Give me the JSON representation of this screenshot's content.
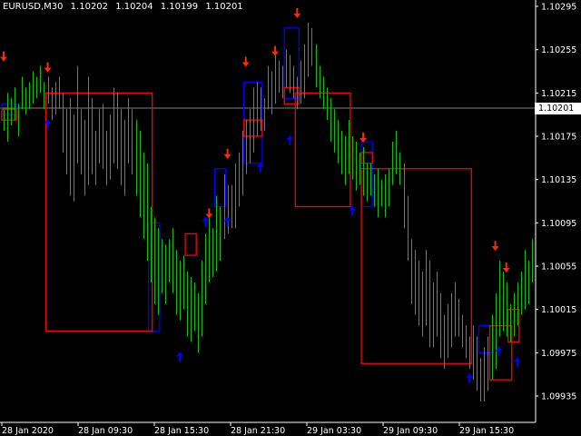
{
  "header": {
    "symbol_timeframe": "EURUSD,M30",
    "open": "1.10202",
    "high": "1.10204",
    "low": "1.10199",
    "close": "1.10201"
  },
  "current_price_label": "1.10201",
  "colors": {
    "background": "#000000",
    "bars": "#00c800",
    "up_box": "#0000ff",
    "down_box": "#ff0000",
    "up_arrow": "#0000ff",
    "down_arrow": "#ff2a00",
    "axis_text": "#ffffff",
    "price_line": "#808080"
  },
  "chart_data": {
    "type": "bar",
    "instrument": "EURUSD",
    "timeframe": "M30",
    "y_axis_ticks": [
      "1.10295",
      "1.10255",
      "1.10215",
      "1.10175",
      "1.10135",
      "1.10095",
      "1.10055",
      "1.10015",
      "1.09975",
      "1.09935"
    ],
    "x_axis_ticks": [
      "28 Jan 2020",
      "28 Jan 09:30",
      "28 Jan 15:30",
      "28 Jan 21:30",
      "29 Jan 03:30",
      "29 Jan 09:30",
      "29 Jan 15:30"
    ],
    "ylim": [
      1.09915,
      1.103
    ],
    "current_price": 1.10201,
    "bars": [
      [
        1.102,
        1.1018
      ],
      [
        1.10215,
        1.1017
      ],
      [
        1.1021,
        1.10185
      ],
      [
        1.1022,
        1.1019
      ],
      [
        1.10205,
        1.10175
      ],
      [
        1.1023,
        1.102
      ],
      [
        1.1022,
        1.10195
      ],
      [
        1.10225,
        1.102
      ],
      [
        1.10235,
        1.10205
      ],
      [
        1.1023,
        1.1021
      ],
      [
        1.1024,
        1.10215
      ],
      [
        1.10225,
        1.102
      ],
      [
        1.1023,
        1.10205
      ],
      [
        1.1022,
        1.1019
      ],
      [
        1.10225,
        1.10195
      ],
      [
        1.1023,
        1.102
      ],
      [
        1.10215,
        1.1016
      ],
      [
        1.102,
        1.1014
      ],
      [
        1.1021,
        1.1012
      ],
      [
        1.10195,
        1.10115
      ],
      [
        1.1024,
        1.1015
      ],
      [
        1.102,
        1.1014
      ],
      [
        1.1019,
        1.1012
      ],
      [
        1.1023,
        1.1013
      ],
      [
        1.1021,
        1.1014
      ],
      [
        1.1018,
        1.1013
      ],
      [
        1.102,
        1.1015
      ],
      [
        1.10205,
        1.10145
      ],
      [
        1.1018,
        1.1013
      ],
      [
        1.10195,
        1.10135
      ],
      [
        1.1022,
        1.1015
      ],
      [
        1.10215,
        1.10145
      ],
      [
        1.102,
        1.1013
      ],
      [
        1.1019,
        1.1012
      ],
      [
        1.1021,
        1.1015
      ],
      [
        1.102,
        1.1014
      ],
      [
        1.1019,
        1.1012
      ],
      [
        1.1018,
        1.101
      ],
      [
        1.1016,
        1.1008
      ],
      [
        1.1015,
        1.1006
      ],
      [
        1.1011,
        1.1004
      ],
      [
        1.101,
        1.1002
      ],
      [
        1.1009,
        1.1001
      ],
      [
        1.1008,
        1.1003
      ],
      [
        1.10075,
        1.1002
      ],
      [
        1.1008,
        1.1004
      ],
      [
        1.1009,
        1.1003
      ],
      [
        1.1007,
        1.1001
      ],
      [
        1.1006,
        1.10005
      ],
      [
        1.10065,
        1.10015
      ],
      [
        1.1005,
        1.0999
      ],
      [
        1.10045,
        1.09985
      ],
      [
        1.1004,
        1.09995
      ],
      [
        1.1003,
        1.09975
      ],
      [
        1.1006,
        1.0999
      ],
      [
        1.10085,
        1.1002
      ],
      [
        1.101,
        1.1004
      ],
      [
        1.1009,
        1.10045
      ],
      [
        1.1012,
        1.1005
      ],
      [
        1.1011,
        1.1006
      ],
      [
        1.1014,
        1.1008
      ],
      [
        1.1013,
        1.10085
      ],
      [
        1.1013,
        1.1009
      ],
      [
        1.1015,
        1.1009
      ],
      [
        1.1016,
        1.1011
      ],
      [
        1.1018,
        1.1012
      ],
      [
        1.1019,
        1.1014
      ],
      [
        1.102,
        1.1015
      ],
      [
        1.1022,
        1.1016
      ],
      [
        1.10225,
        1.10175
      ],
      [
        1.1022,
        1.1018
      ],
      [
        1.1021,
        1.1018
      ],
      [
        1.1024,
        1.102
      ],
      [
        1.10235,
        1.10195
      ],
      [
        1.1025,
        1.10205
      ],
      [
        1.10245,
        1.10215
      ],
      [
        1.1024,
        1.1021
      ],
      [
        1.10255,
        1.1022
      ],
      [
        1.1025,
        1.10215
      ],
      [
        1.1024,
        1.1021
      ],
      [
        1.1023,
        1.102
      ],
      [
        1.10245,
        1.10205
      ],
      [
        1.1026,
        1.1021
      ],
      [
        1.1028,
        1.1023
      ],
      [
        1.10275,
        1.1024
      ],
      [
        1.1026,
        1.1022
      ],
      [
        1.1024,
        1.1021
      ],
      [
        1.1023,
        1.102
      ],
      [
        1.1022,
        1.1019
      ],
      [
        1.1021,
        1.1017
      ],
      [
        1.102,
        1.1016
      ],
      [
        1.1019,
        1.1015
      ],
      [
        1.1018,
        1.1014
      ],
      [
        1.10175,
        1.1013
      ],
      [
        1.1019,
        1.1014
      ],
      [
        1.10175,
        1.10135
      ],
      [
        1.1017,
        1.10125
      ],
      [
        1.1016,
        1.1013
      ],
      [
        1.10165,
        1.1012
      ],
      [
        1.1015,
        1.10115
      ],
      [
        1.1015,
        1.1012
      ],
      [
        1.1014,
        1.1011
      ],
      [
        1.10145,
        1.101
      ],
      [
        1.10135,
        1.1011
      ],
      [
        1.1014,
        1.101
      ],
      [
        1.10145,
        1.1011
      ],
      [
        1.1017,
        1.1013
      ],
      [
        1.1018,
        1.1014
      ],
      [
        1.1016,
        1.1013
      ],
      [
        1.1015,
        1.1009
      ],
      [
        1.1012,
        1.1006
      ],
      [
        1.1008,
        1.1002
      ],
      [
        1.1007,
        1.1001
      ],
      [
        1.1006,
        1.1
      ],
      [
        1.1005,
        1.0999
      ],
      [
        1.1007,
        1.1
      ],
      [
        1.1006,
        1.0998
      ],
      [
        1.1004,
        1.0998
      ],
      [
        1.1005,
        1.0999
      ],
      [
        1.1003,
        1.0997
      ],
      [
        1.1001,
        1.0996
      ],
      [
        1.1002,
        1.0997
      ],
      [
        1.1003,
        1.0998
      ],
      [
        1.1004,
        1.0999
      ],
      [
        1.10025,
        1.0999
      ],
      [
        1.1001,
        1.0998
      ],
      [
        1.1,
        1.0997
      ],
      [
        1.0999,
        1.0996
      ],
      [
        1.1,
        1.0995
      ],
      [
        1.0999,
        1.0994
      ],
      [
        1.0997,
        1.0993
      ],
      [
        1.0998,
        1.0993
      ],
      [
        1.0999,
        1.0994
      ],
      [
        1.1001,
        1.0995
      ],
      [
        1.1003,
        1.0996
      ],
      [
        1.1006,
        1.0999
      ],
      [
        1.1005,
        1.09995
      ],
      [
        1.1004,
        1.0999
      ],
      [
        1.1002,
        1.09985
      ],
      [
        1.1003,
        1.0999
      ],
      [
        1.1004,
        1.1
      ],
      [
        1.1005,
        1.1001
      ],
      [
        1.1007,
        1.10015
      ],
      [
        1.1006,
        1.1002
      ],
      [
        1.1008,
        1.1004
      ]
    ],
    "up_boxes": [
      [
        0,
        3,
        1.10205,
        1.10195
      ],
      [
        40,
        42,
        1.10095,
        1.09995
      ],
      [
        58,
        60,
        1.10145,
        1.1011
      ],
      [
        66,
        70,
        1.10225,
        1.1015
      ],
      [
        77,
        80,
        1.10275,
        1.1021
      ],
      [
        98,
        100,
        1.1017,
        1.1011
      ],
      [
        130,
        133,
        1.1,
        1.09975
      ]
    ],
    "down_boxes": [
      [
        0,
        3,
        1.102,
        1.1019
      ],
      [
        12,
        40,
        1.10215,
        1.09995
      ],
      [
        50,
        52,
        1.10085,
        1.10065
      ],
      [
        66,
        70,
        1.1019,
        1.10175
      ],
      [
        77,
        80,
        1.1022,
        1.10205
      ],
      [
        80,
        94,
        1.10215,
        1.1011
      ],
      [
        98,
        100,
        1.1016,
        1.1015
      ],
      [
        98,
        127,
        1.10145,
        1.09965
      ],
      [
        133,
        138,
        1.1,
        1.0995
      ],
      [
        138,
        140,
        1.10015,
        1.09985
      ]
    ],
    "up_arrows": [
      [
        12,
        1.1019
      ],
      [
        48,
        1.09975
      ],
      [
        55,
        1.101
      ],
      [
        61,
        1.101
      ],
      [
        70,
        1.1015
      ],
      [
        78,
        1.10175
      ],
      [
        95,
        1.1011
      ],
      [
        127,
        1.09955
      ],
      [
        135,
        1.0998
      ],
      [
        140,
        1.0997
      ]
    ],
    "down_arrows": [
      [
        0,
        1.10245
      ],
      [
        12,
        1.10235
      ],
      [
        56,
        1.101
      ],
      [
        61,
        1.10155
      ],
      [
        66,
        1.1024
      ],
      [
        74,
        1.1025
      ],
      [
        80,
        1.10285
      ],
      [
        98,
        1.1017
      ],
      [
        134,
        1.1007
      ],
      [
        137,
        1.1005
      ]
    ]
  }
}
